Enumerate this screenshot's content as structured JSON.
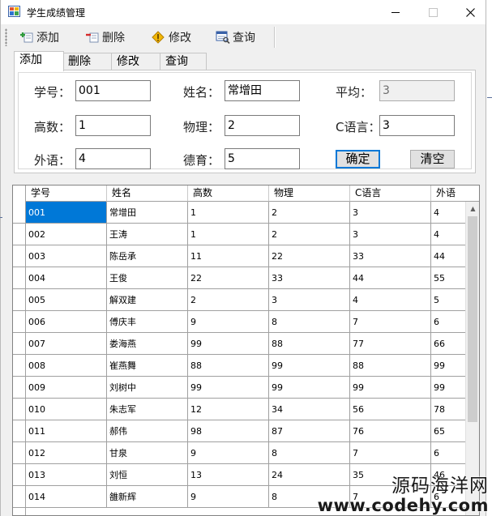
{
  "window": {
    "title": "学生成绩管理"
  },
  "toolbar": {
    "items": [
      {
        "label": "添加",
        "icon": "add-icon"
      },
      {
        "label": "删除",
        "icon": "delete-icon"
      },
      {
        "label": "修改",
        "icon": "edit-icon"
      },
      {
        "label": "查询",
        "icon": "search-icon"
      }
    ]
  },
  "tabs": [
    {
      "label": "添加",
      "active": true
    },
    {
      "label": "删除",
      "active": false
    },
    {
      "label": "修改",
      "active": false
    },
    {
      "label": "查询",
      "active": false
    }
  ],
  "form": {
    "id_label": "学号：",
    "id_value": "001",
    "name_label": "姓名：",
    "name_value": "常增田",
    "avg_label": "平均：",
    "avg_value": "3",
    "math_label": "高数：",
    "math_value": "1",
    "physics_label": "物理：",
    "physics_value": "2",
    "c_label": "C语言：",
    "c_value": "3",
    "english_label": "外语：",
    "english_value": "4",
    "moral_label": "德育：",
    "moral_value": "5",
    "confirm_label": "确定",
    "clear_label": "清空"
  },
  "grid": {
    "columns": [
      "学号",
      "姓名",
      "高数",
      "物理",
      "C语言",
      "外语"
    ],
    "rows": [
      [
        "001",
        "常增田",
        "1",
        "2",
        "3",
        "4"
      ],
      [
        "002",
        "王涛",
        "1",
        "2",
        "3",
        "4"
      ],
      [
        "003",
        "陈岳承",
        "11",
        "22",
        "33",
        "44"
      ],
      [
        "004",
        "王俊",
        "22",
        "33",
        "44",
        "55"
      ],
      [
        "005",
        "解双建",
        "2",
        "3",
        "4",
        "5"
      ],
      [
        "006",
        "傅庆丰",
        "9",
        "8",
        "7",
        "6"
      ],
      [
        "007",
        "娄海燕",
        "99",
        "88",
        "77",
        "66"
      ],
      [
        "008",
        "崔燕舞",
        "88",
        "99",
        "88",
        "99"
      ],
      [
        "009",
        "刘树中",
        "99",
        "99",
        "99",
        "99"
      ],
      [
        "010",
        "朱志军",
        "12",
        "34",
        "56",
        "78"
      ],
      [
        "011",
        "郝伟",
        "98",
        "87",
        "76",
        "65"
      ],
      [
        "012",
        "甘泉",
        "9",
        "8",
        "7",
        "6"
      ],
      [
        "013",
        "刘恒",
        "13",
        "24",
        "35",
        "46"
      ],
      [
        "014",
        "雒新辉",
        "9",
        "8",
        "7",
        "6"
      ]
    ]
  },
  "watermark": {
    "text": "源码海洋网",
    "url": "www.codehy.com"
  },
  "colors": {
    "selection": "#0078d7",
    "window_bg": "#f0f0f0"
  }
}
